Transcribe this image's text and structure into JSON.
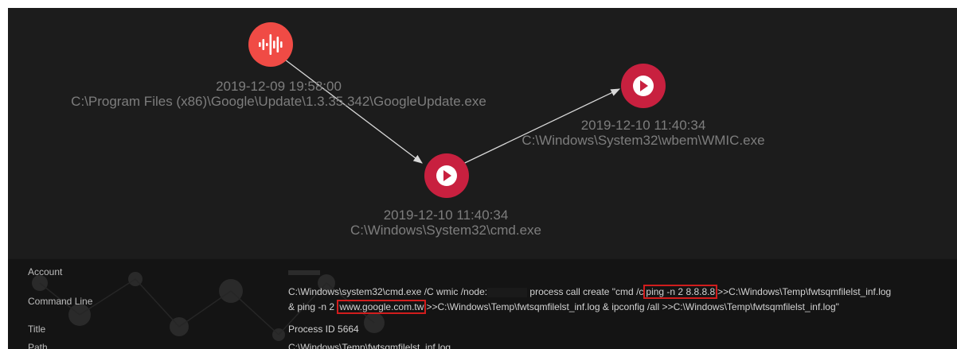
{
  "graph": {
    "nodes": [
      {
        "id": "googleupdate",
        "timestamp": "2019-12-09 19:58:00",
        "path": "C:\\Program Files (x86)\\Google\\Update\\1.3.35.342\\GoogleUpdate.exe",
        "icon": "audio-waveform-icon",
        "color": "#f04b45"
      },
      {
        "id": "wmic",
        "timestamp": "2019-12-10 11:40:34",
        "path": "C:\\Windows\\System32\\wbem\\WMIC.exe",
        "icon": "play-icon",
        "color": "#c8203f"
      },
      {
        "id": "cmd",
        "timestamp": "2019-12-10 11:40:34",
        "path": "C:\\Windows\\System32\\cmd.exe",
        "icon": "play-icon",
        "color": "#c8203f"
      }
    ],
    "edges": [
      {
        "from": "googleupdate",
        "to": "cmd"
      },
      {
        "from": "cmd",
        "to": "wmic"
      }
    ]
  },
  "details": {
    "account": {
      "label": "Account",
      "value": ""
    },
    "command_line": {
      "label": "Command Line",
      "line1_a": "C:\\Windows\\system32\\cmd.exe /C wmic /node:",
      "line1_b": "process call create \"cmd /c",
      "line1_hl": "ping -n 2 8.8.8.8",
      "line1_c": ">>C:\\Windows\\Temp\\fwtsqmfilelst_inf.log",
      "line2_a": "& ping -n 2",
      "line2_hl": "www.google.com.tw",
      "line2_c": ">>C:\\Windows\\Temp\\fwtsqmfilelst_inf.log & ipconfig /all >>C:\\Windows\\Temp\\fwtsqmfilelst_inf.log\""
    },
    "title": {
      "label": "Title",
      "value": "Process ID 5664"
    },
    "path": {
      "label": "Path",
      "value": "C:\\Windows\\Temp\\fwtsqmfilelst_inf.log"
    }
  },
  "colors": {
    "highlight": "#d11d1d",
    "edge": "#d8d8d8",
    "label": "#7d7d7d"
  }
}
